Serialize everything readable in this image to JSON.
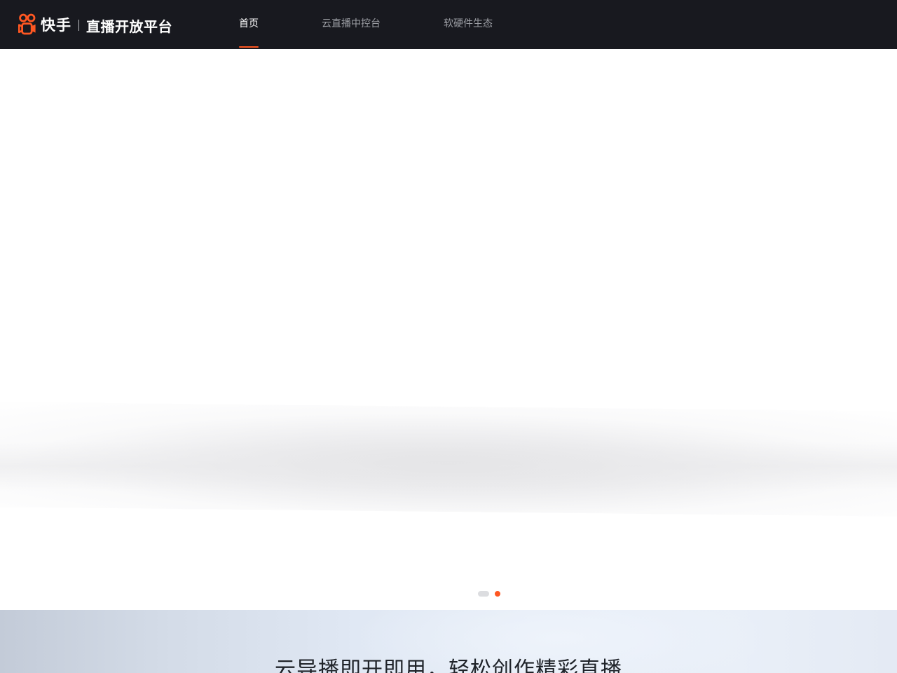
{
  "header": {
    "brand": {
      "name": "快手",
      "subtitle": "直播开放平台"
    },
    "nav": [
      {
        "label": "首页",
        "active": true
      },
      {
        "label": "云直播中控台",
        "active": false
      },
      {
        "label": "软硬件生态",
        "active": false
      }
    ]
  },
  "hero": {
    "carousel": {
      "slide_count": 2,
      "active_index": 1
    }
  },
  "feature": {
    "title": "云导播即开即用，轻松创作精彩直播"
  },
  "colors": {
    "header_bg": "#18191f",
    "accent": "#fe5722",
    "nav_inactive": "#9c9ea4",
    "nav_active": "#ffffff"
  },
  "icons": {
    "brand_logo": "kuaishou-logo-icon"
  }
}
